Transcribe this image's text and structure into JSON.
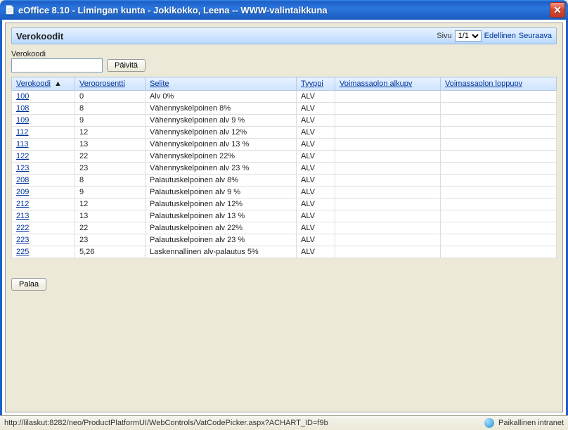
{
  "window": {
    "title": "eOffice 8.10 - Limingan kunta - Jokikokko, Leena -- WWW-valintaikkuna",
    "close_symbol": "✕"
  },
  "panel": {
    "title": "Verokoodit",
    "page_label": "Sivu",
    "page_value": "1/1",
    "prev_label": "Edellinen",
    "next_label": "Seuraava"
  },
  "filter": {
    "label": "Verokoodi",
    "value": "",
    "refresh_label": "Päivitä"
  },
  "columns": {
    "verokoodi": "Verokoodi",
    "veroprosentti": "Veroprosentti",
    "selite": "Selite",
    "tyyppi": "Tyyppi",
    "alkupv": "Voimassaolon alkupv",
    "loppupv": "Voimassaolon loppupv",
    "sort_indicator": "▲"
  },
  "rows": [
    {
      "code": "100",
      "pct": "0",
      "selite": "Alv 0%",
      "type": "ALV",
      "a": "",
      "b": ""
    },
    {
      "code": "108",
      "pct": "8",
      "selite": "Vähennyskelpoinen 8%",
      "type": "ALV",
      "a": "",
      "b": ""
    },
    {
      "code": "109",
      "pct": "9",
      "selite": "Vähennyskelpoinen alv 9 %",
      "type": "ALV",
      "a": "",
      "b": ""
    },
    {
      "code": "112",
      "pct": "12",
      "selite": "Vähennyskelpoinen alv 12%",
      "type": "ALV",
      "a": "",
      "b": ""
    },
    {
      "code": "113",
      "pct": "13",
      "selite": "Vähennyskelpoinen alv 13 %",
      "type": "ALV",
      "a": "",
      "b": ""
    },
    {
      "code": "122",
      "pct": "22",
      "selite": "Vähennyskelpoinen 22%",
      "type": "ALV",
      "a": "",
      "b": ""
    },
    {
      "code": "123",
      "pct": "23",
      "selite": "Vähennyskelpoinen alv 23 %",
      "type": "ALV",
      "a": "",
      "b": ""
    },
    {
      "code": "208",
      "pct": "8",
      "selite": "Palautuskelpoinen alv 8%",
      "type": "ALV",
      "a": "",
      "b": ""
    },
    {
      "code": "209",
      "pct": "9",
      "selite": "Palautuskelpoinen alv 9 %",
      "type": "ALV",
      "a": "",
      "b": ""
    },
    {
      "code": "212",
      "pct": "12",
      "selite": "Palautuskelpoinen alv 12%",
      "type": "ALV",
      "a": "",
      "b": ""
    },
    {
      "code": "213",
      "pct": "13",
      "selite": "Palautuskelpoinen alv 13 %",
      "type": "ALV",
      "a": "",
      "b": ""
    },
    {
      "code": "222",
      "pct": "22",
      "selite": "Palautuskelpoinen alv 22%",
      "type": "ALV",
      "a": "",
      "b": ""
    },
    {
      "code": "223",
      "pct": "23",
      "selite": "Palautuskelpoinen alv 23 %",
      "type": "ALV",
      "a": "",
      "b": ""
    },
    {
      "code": "225",
      "pct": "5,26",
      "selite": "Laskennallinen alv-palautus 5%",
      "type": "ALV",
      "a": "",
      "b": ""
    }
  ],
  "footer": {
    "back_label": "Palaa"
  },
  "status": {
    "url": "http://lilaskut:8282/neo/ProductPlatformUI/WebControls/VatCodePicker.aspx?ACHART_ID=f9b",
    "zone": "Paikallinen intranet"
  }
}
